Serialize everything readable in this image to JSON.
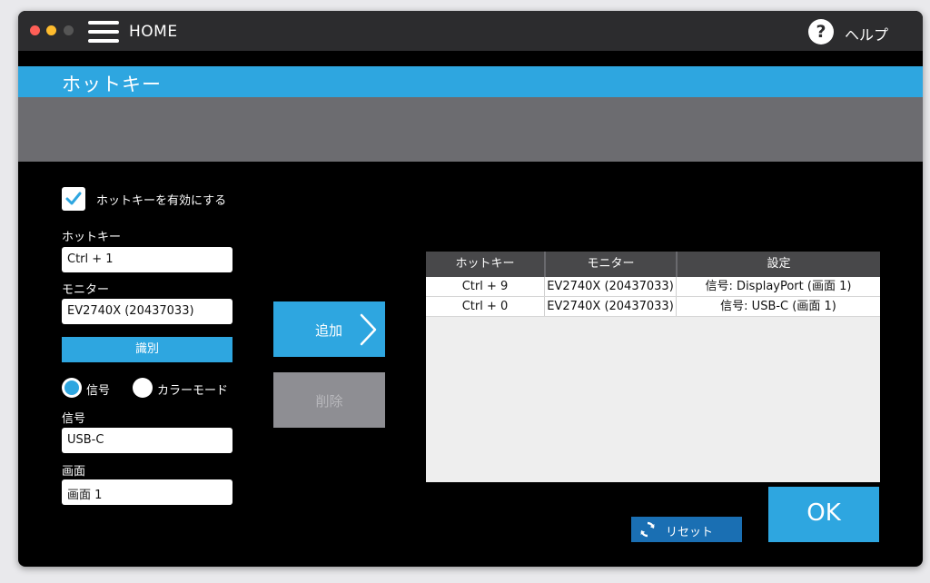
{
  "titlebar": {
    "home_label": "HOME",
    "help_icon": "?",
    "help_label": "ヘルプ"
  },
  "section": {
    "title": "ホットキー"
  },
  "form": {
    "enable_label": "ホットキーを有効にする",
    "enable_checked": true,
    "hotkey_label": "ホットキー",
    "hotkey_value": "Ctrl + 1",
    "monitor_label": "モニター",
    "monitor_value": "EV2740X (20437033)",
    "identify_label": "識別",
    "radio_signal_label": "信号",
    "radio_color_mode_label": "カラーモード",
    "radio_selected": "signal",
    "signal_label": "信号",
    "signal_value": "USB-C",
    "screen_label": "画面",
    "screen_value": "画面 1"
  },
  "actions": {
    "add_label": "追加",
    "delete_label": "削除",
    "reset_label": "リセット",
    "ok_label": "OK"
  },
  "table": {
    "headers": [
      "ホットキー",
      "モニター",
      "設定"
    ],
    "rows": [
      [
        "Ctrl + 9",
        "EV2740X (20437033)",
        "信号: DisplayPort (画面 1)"
      ],
      [
        "Ctrl + 0",
        "EV2740X (20437033)",
        "信号: USB-C (画面 1)"
      ]
    ]
  },
  "colors": {
    "accent": "#2ea6e0",
    "reset_button": "#1a6fb3",
    "disabled_button": "#8e8e93",
    "titlebar": "#2c2c2e",
    "band": "#6c6c70"
  },
  "icons": {
    "menu": "hamburger-menu-icon",
    "help": "question-mark-icon",
    "checkbox": "checkmark-icon",
    "add": "chevron-right-icon",
    "reset": "refresh-icon"
  }
}
